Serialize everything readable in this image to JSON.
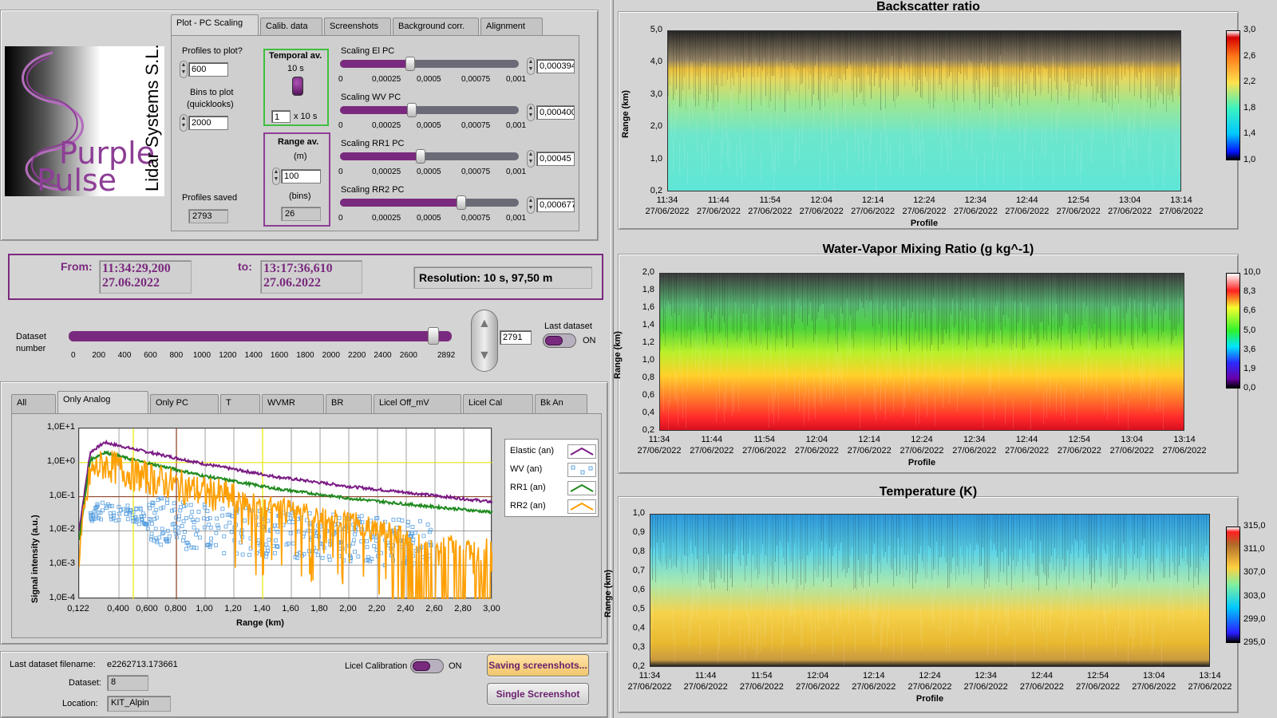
{
  "logo": {
    "brand_line1": "Purple",
    "brand_line2": "Pulse",
    "company": "Lidar Systems S.L."
  },
  "tabs_top": [
    "Plot - PC Scaling",
    "Calib. data",
    "Screenshots",
    "Background corr.",
    "Alignment"
  ],
  "controls": {
    "profiles_to_plot_label": "Profiles to plot?",
    "profiles_to_plot": "600",
    "bins_to_plot_label": "Bins to plot",
    "bins_to_plot_label2": "(quicklooks)",
    "bins_to_plot": "2000",
    "profiles_saved_label": "Profiles saved",
    "profiles_saved": "2793",
    "temporal_av_label": "Temporal av.",
    "temporal_av_value": "10 s",
    "temporal_mult": "1",
    "temporal_mult_unit": "x 10 s",
    "range_av_label": "Range av.",
    "range_av_unit": "(m)",
    "range_av_m": "100",
    "range_av_bins_unit": "(bins)",
    "range_av_bins": "26"
  },
  "scaling_ticks": [
    "0",
    "0,00025",
    "0,0005",
    "0,00075",
    "0,001"
  ],
  "scaling_sliders": [
    {
      "label": "Scaling El PC",
      "value": "0,000394",
      "level": 0.394
    },
    {
      "label": "Scaling WV PC",
      "value": "0,000400",
      "level": 0.4
    },
    {
      "label": "Scaling RR1 PC",
      "value": "0,00045",
      "level": 0.45
    },
    {
      "label": "Scaling RR2 PC",
      "value": "0,000677",
      "level": 0.677
    }
  ],
  "time_range": {
    "from_label": "From:",
    "from_time": "11:34:29,200",
    "from_date": "27.06.2022",
    "to_label": "to:",
    "to_time": "13:17:36,610",
    "to_date": "27.06.2022",
    "resolution": "Resolution: 10 s, 97,50 m"
  },
  "dataset": {
    "label1": "Dataset",
    "label2": "number",
    "ticks": [
      "0",
      "200",
      "400",
      "600",
      "800",
      "1000",
      "1200",
      "1400",
      "1600",
      "1800",
      "2000",
      "2200",
      "2400",
      "2600",
      "2892"
    ],
    "value": "2791",
    "slider_max": 2892,
    "last_dataset_label": "Last dataset",
    "last_dataset_state": "ON"
  },
  "tabs_bottom": [
    "All",
    "Only Analog",
    "Only PC",
    "T",
    "WVMR",
    "BR",
    "Licel Off_mV",
    "Licel Cal",
    "Bk An"
  ],
  "signal_chart": {
    "ylabel": "Signal intensity (a.u.)",
    "xlabel": "Range (km)",
    "yticks": [
      "1,0E+1",
      "1,0E+0",
      "1,0E-1",
      "1,0E-2",
      "1,0E-3",
      "1,0E-4"
    ],
    "xticks": [
      "0,122",
      "0,400",
      "0,600",
      "0,800",
      "1,00",
      "1,20",
      "1,40",
      "1,60",
      "1,80",
      "2,00",
      "2,20",
      "2,40",
      "2,60",
      "2,80",
      "3,00"
    ],
    "legend": [
      "Elastic (an)",
      "WV (an)",
      "RR1 (an)",
      "RR2 (an)"
    ]
  },
  "chart_data": [
    {
      "type": "line",
      "ylabel": "Signal intensity (a.u.)",
      "xlabel": "Range (km)",
      "xlim": [
        0.122,
        3.0
      ],
      "ylim": [
        0.0001,
        10
      ],
      "yscale": "log",
      "series": [
        {
          "name": "Elastic (an)",
          "color": "#7a1b84",
          "x": [
            0.122,
            0.2,
            0.3,
            0.5,
            1.0,
            1.5,
            2.0,
            2.5,
            3.0
          ],
          "y": [
            0.01,
            2.0,
            3.9,
            2.5,
            0.9,
            0.38,
            0.2,
            0.12,
            0.07
          ]
        },
        {
          "name": "WV (an)",
          "color": "#5aa0e0",
          "x": [
            0.2,
            0.3,
            0.5,
            0.8,
            1.0,
            1.5,
            2.0,
            2.5
          ],
          "y": [
            0.03,
            0.04,
            0.03,
            0.015,
            0.012,
            0.008,
            0.006,
            0.004
          ]
        },
        {
          "name": "RR1 (an)",
          "color": "#1f8a1f",
          "x": [
            0.122,
            0.2,
            0.3,
            0.5,
            1.0,
            1.5,
            2.0,
            2.5,
            3.0
          ],
          "y": [
            0.005,
            1.2,
            2.0,
            1.2,
            0.4,
            0.17,
            0.09,
            0.055,
            0.035
          ]
        },
        {
          "name": "RR2 (an)",
          "color": "#ff9f00",
          "x": [
            0.122,
            0.2,
            0.3,
            0.5,
            1.0,
            1.5,
            2.0,
            2.5,
            3.0
          ],
          "y": [
            0.002,
            0.5,
            0.9,
            0.45,
            0.13,
            0.05,
            0.02,
            0.005,
            0.003
          ]
        }
      ]
    },
    {
      "type": "heatmap",
      "title": "Backscatter ratio",
      "xlabel": "Profile",
      "ylabel": "Range (km)",
      "ylim": [
        0.2,
        5.0
      ],
      "yticks": [
        "5,0",
        "4,0",
        "3,0",
        "2,0",
        "1,0",
        "0,2"
      ],
      "xticks": [
        "11:34",
        "11:44",
        "11:54",
        "12:04",
        "12:14",
        "12:24",
        "12:34",
        "12:44",
        "12:54",
        "13:04",
        "13:14"
      ],
      "xdates": "27/06/2022",
      "colorbar": [
        "3,0",
        "2,6",
        "2,2",
        "1,8",
        "1,4",
        "1,0"
      ]
    },
    {
      "type": "heatmap",
      "title": "Water-Vapor Mixing Ratio  (g kg^-1)",
      "xlabel": "Profile",
      "ylabel": "Range (km)",
      "ylim": [
        0.2,
        2.0
      ],
      "yticks": [
        "2,0",
        "1,8",
        "1,6",
        "1,4",
        "1,2",
        "1,0",
        "0,8",
        "0,6",
        "0,4",
        "0,2"
      ],
      "xticks": [
        "11:34",
        "11:44",
        "11:54",
        "12:04",
        "12:14",
        "12:24",
        "12:34",
        "12:44",
        "12:54",
        "13:04",
        "13:14"
      ],
      "xdates": "27/06/2022",
      "colorbar": [
        "10,0",
        "8,3",
        "6,6",
        "5,0",
        "3,6",
        "1,9",
        "0,0"
      ]
    },
    {
      "type": "heatmap",
      "title": "Temperature (K)",
      "xlabel": "Profile",
      "ylabel": "Range (km)",
      "ylim": [
        0.2,
        1.0
      ],
      "yticks": [
        "1,0",
        "0,9",
        "0,8",
        "0,7",
        "0,6",
        "0,5",
        "0,4",
        "0,3",
        "0,2"
      ],
      "xticks": [
        "11:34",
        "11:44",
        "11:54",
        "12:04",
        "12:14",
        "12:24",
        "12:34",
        "12:44",
        "12:54",
        "13:04",
        "13:14"
      ],
      "xdates": "27/06/2022",
      "colorbar": [
        "315,0",
        "311,0",
        "307,0",
        "303,0",
        "299,0",
        "295,0"
      ]
    }
  ],
  "footer": {
    "filename_label": "Last dataset filename:",
    "filename": "e2262713.173661",
    "dataset_label": "Dataset:",
    "dataset": "8",
    "location_label": "Location:",
    "location": "KIT_Alpin",
    "licel_label": "Licel Calibration",
    "licel_state": "ON",
    "btn_saving": "Saving screenshots...",
    "btn_single": "Single Screenshot"
  },
  "colors": {
    "accent": "#7a2a7e",
    "panel": "#d4d4d4"
  }
}
